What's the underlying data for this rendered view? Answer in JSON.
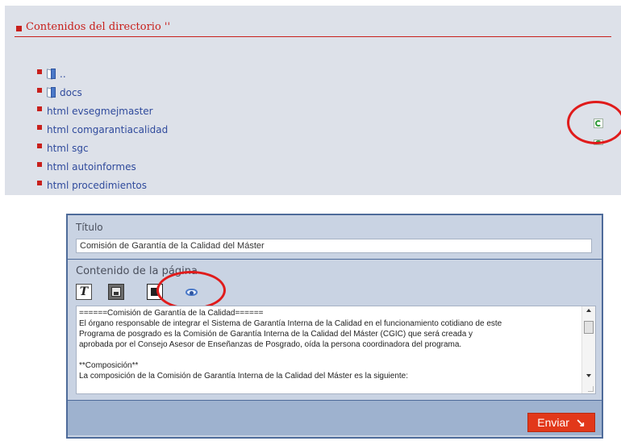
{
  "directory": {
    "title": "Contenidos del directorio ''",
    "items": [
      {
        "label": "..",
        "type": "folder"
      },
      {
        "label": "docs",
        "type": "folder"
      },
      {
        "label": "html evsegmejmaster",
        "type": "html"
      },
      {
        "label": "html comgarantiacalidad",
        "type": "html"
      },
      {
        "label": "html sgc",
        "type": "html"
      },
      {
        "label": "html autoinformes",
        "type": "html"
      },
      {
        "label": "html procedimientos",
        "type": "html"
      }
    ],
    "row_icons": [
      "sync-icon",
      "sync-icon"
    ]
  },
  "editor": {
    "title_label": "Título",
    "title_value": "Comisión de Garantía de la Calidad del Máster",
    "content_label": "Contenido de la página",
    "toolbar": {
      "bold_glyph": "T",
      "icons": [
        "bold-icon",
        "save-icon",
        "image-icon",
        "preview-eye-icon"
      ]
    },
    "content_lines": [
      "======Comisión de Garantía de la Calidad======",
      "El órgano responsable de integrar el Sistema de Garantía Interna de la Calidad en el funcionamiento cotidiano de este",
      "Programa de posgrado es la Comisión de Garantía Interna de la Calidad del Máster (CGIC) que será creada y",
      "aprobada por el Consejo Asesor de Enseñanzas de Posgrado, oída la persona coordinadora del programa.",
      "",
      "**Composición**",
      "La composición de la Comisión de Garantía Interna de la Calidad del Máster es la siguiente:"
    ],
    "submit_label": "Enviar",
    "submit_arrow": "↘"
  },
  "colors": {
    "accent_red": "#c8201c",
    "panel_bg": "#dde1e9",
    "editor_bg": "#c9d3e3",
    "button_red": "#e2381a",
    "link_blue": "#2f4a9c",
    "highlight_circle": "#e01b1b"
  }
}
